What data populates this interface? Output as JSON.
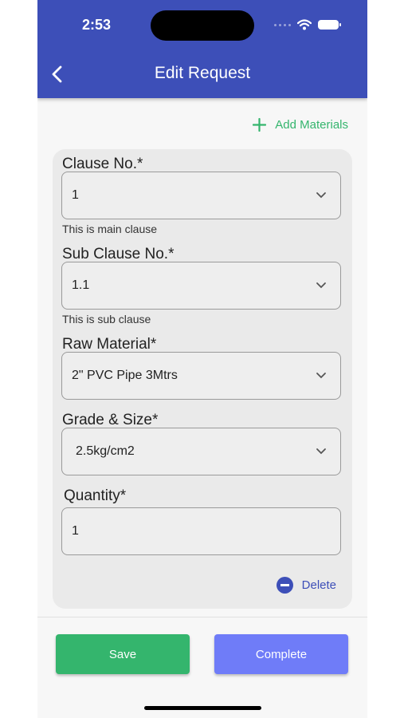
{
  "status_bar": {
    "time": "2:53"
  },
  "header": {
    "title": "Edit Request"
  },
  "actions": {
    "add_materials": "Add Materials",
    "delete": "Delete"
  },
  "form": {
    "clause": {
      "label": "Clause No.*",
      "value": "1",
      "helper": "This is main clause"
    },
    "sub_clause": {
      "label": "Sub Clause No.*",
      "value": "1.1",
      "helper": "This is sub clause"
    },
    "raw_material": {
      "label": "Raw Material*",
      "value": "2\" PVC Pipe 3Mtrs"
    },
    "grade_size": {
      "label": "Grade & Size*",
      "value": "2.5kg/cm2"
    },
    "quantity": {
      "label": "Quantity*",
      "value": "1"
    }
  },
  "buttons": {
    "save": "Save",
    "complete": "Complete"
  },
  "colors": {
    "primary": "#3d4fb8",
    "green": "#34b56d",
    "complete_button": "#6f7cf8"
  },
  "icons": [
    "back-arrow-icon",
    "wifi-icon",
    "battery-icon",
    "plus-icon",
    "chevron-down-icon",
    "minus-circle-icon"
  ]
}
